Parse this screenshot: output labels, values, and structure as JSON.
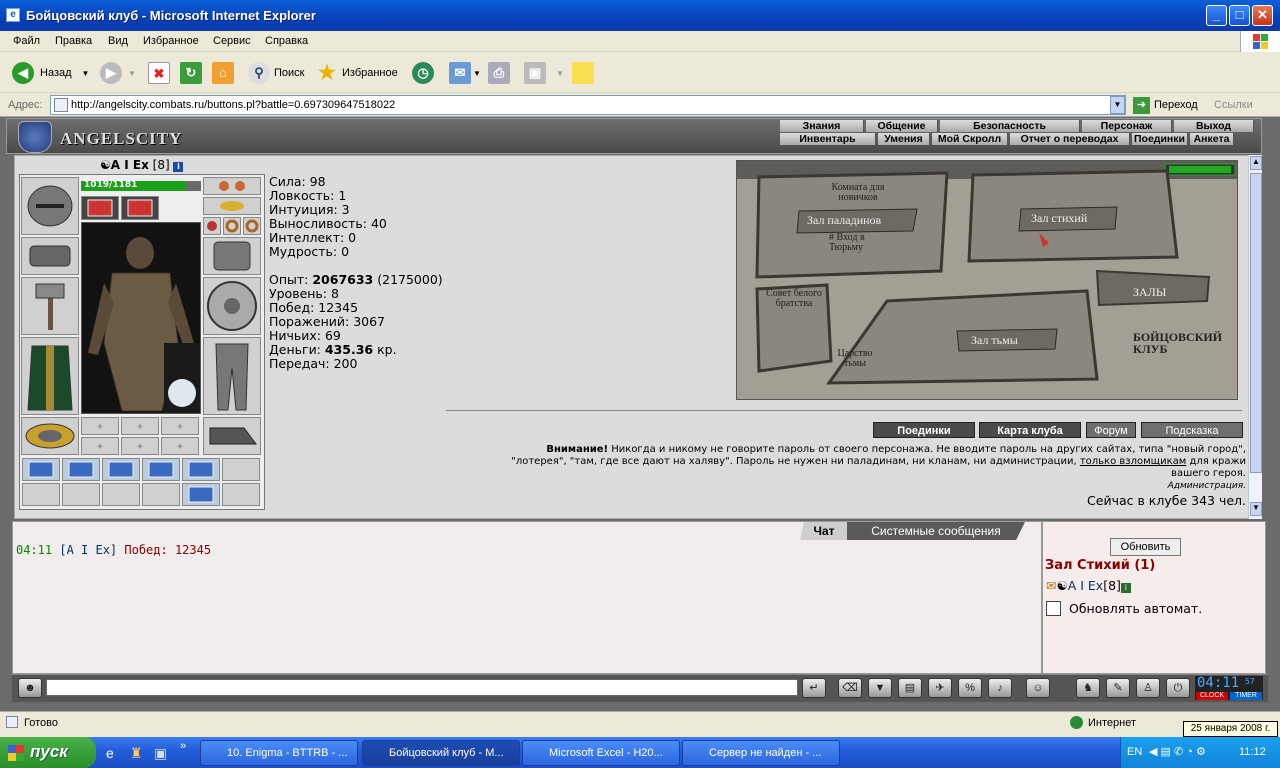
{
  "window": {
    "title": "Бойцовский клуб - Microsoft Internet Explorer"
  },
  "menu": [
    "Файл",
    "Правка",
    "Вид",
    "Избранное",
    "Сервис",
    "Справка"
  ],
  "toolbar": {
    "back": "Назад",
    "search": "Поиск",
    "favorites": "Избранное"
  },
  "address": {
    "label": "Адрес:",
    "url": "http://angelscity.combats.ru/buttons.pl?battle=0.697309647518022",
    "go": "Переход",
    "links": "Ссылки"
  },
  "game": {
    "logo": "ANGELSCITY",
    "nav_top": [
      "Знания",
      "Общение",
      "Безопасность",
      "Персонаж",
      "Выход"
    ],
    "nav_bottom": [
      "Инвентарь",
      "Умения",
      "Мой Скролл",
      "Отчет о переводах",
      "Поединки",
      "Анкета"
    ],
    "character": {
      "name": "A I Ex",
      "level": "[8]",
      "hp": "1019/1181",
      "hp_fraction": 0.863
    },
    "stats": {
      "strength": "Сила: 98",
      "agility": "Ловкость: 1",
      "intuition": "Интуиция: 3",
      "endurance": "Выносливость: 40",
      "intellect": "Интеллект: 0",
      "wisdom": "Мудрость: 0",
      "exp_label": "Опыт: ",
      "exp_value": "2067633",
      "exp_next": "(2175000)",
      "level": "Уровень: 8",
      "wins": "Побед: 12345",
      "losses": "Поражений: 3067",
      "draws": "Ничьих: 69",
      "money_label": "Деньги: ",
      "money_value": "435.36",
      "money_unit": " кр.",
      "transfers": "Передач: 200"
    },
    "map": {
      "labels": [
        "Комната для новичков",
        "Зал паладинов",
        "# Вход в Тюрьму",
        "Зал стихий",
        "Совет белого братства",
        "ЗАЛЫ",
        "Зал тьмы",
        "Царство тьмы",
        "БОЙЦОВСКИЙ КЛУБ"
      ]
    },
    "buttons": [
      "Поединки",
      "Карта клуба",
      "Форум",
      "Подсказка"
    ],
    "warning": {
      "bold": "Внимание!",
      "line1": " Никогда и никому не говорите пароль от своего персонажа. Не вводите пароль на других сайтах, типа \"новый город\",",
      "line2a": "\"лотерея\", \"там, где все дают на халяву\". Пароль не нужен ни паладинам, ни кланам, ни администрации, ",
      "link": "только взломщикам",
      "line2b": " для кражи",
      "line3": "вашего героя.",
      "signature": "Администрация."
    },
    "online": "Сейчас в клубе 343 чел.",
    "chat": {
      "tab_chat": "Чат",
      "tab_system": "Системные сообщения",
      "time": "04:11",
      "user": "[A I Ex]",
      "message": " Побед: 12345"
    },
    "side": {
      "refresh": "Обновить",
      "room": "Зал Стихий (1)",
      "user": "A I Ex",
      "user_level": "[8]",
      "auto_refresh": "Обновлять автомат."
    },
    "clock": {
      "time": "04:11",
      "seconds": "57",
      "clock_label": "CLOCK",
      "timer_label": "TIMER"
    }
  },
  "status": {
    "text": "Готово",
    "zone": "Интернет",
    "tooltip": "25 января 2008 г."
  },
  "taskbar": {
    "start": "пуск",
    "tasks": [
      "10. Enigma - BTTRB - ...",
      "Бойцовский клуб - М...",
      "Microsoft Excel - H20...",
      "Сервер не найден - ..."
    ],
    "lang": "EN",
    "time": "11:12"
  }
}
